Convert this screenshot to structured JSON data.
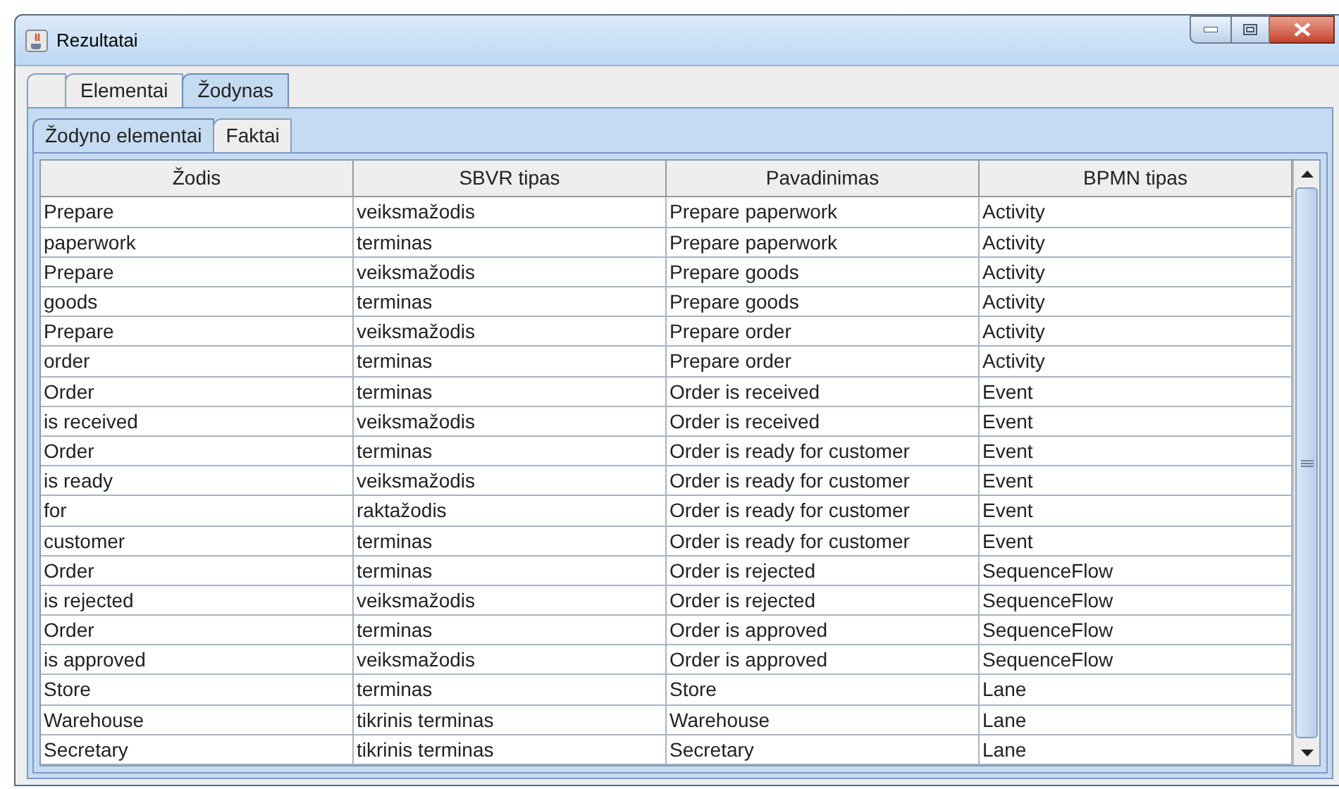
{
  "window": {
    "title": "Rezultatai"
  },
  "tabs": [
    {
      "selected": false
    },
    {
      "label": "Elementai",
      "selected": false
    },
    {
      "label": "Žodynas",
      "selected": true
    }
  ],
  "subtabs": [
    {
      "label": "Žodyno elementai",
      "selected": true
    },
    {
      "label": "Faktai",
      "selected": false
    }
  ],
  "table": {
    "columns": [
      "Žodis",
      "SBVR tipas",
      "Pavadinimas",
      "BPMN tipas"
    ],
    "rows": [
      [
        "Prepare",
        "veiksmažodis",
        "Prepare paperwork",
        "Activity"
      ],
      [
        "paperwork",
        "terminas",
        "Prepare paperwork",
        "Activity"
      ],
      [
        "Prepare",
        "veiksmažodis",
        "Prepare goods",
        "Activity"
      ],
      [
        "goods",
        "terminas",
        "Prepare goods",
        "Activity"
      ],
      [
        "Prepare",
        "veiksmažodis",
        "Prepare order",
        "Activity"
      ],
      [
        "order",
        "terminas",
        "Prepare order",
        "Activity"
      ],
      [
        "Order",
        "terminas",
        "Order is received",
        "Event"
      ],
      [
        "is received",
        "veiksmažodis",
        "Order is received",
        "Event"
      ],
      [
        "Order",
        "terminas",
        "Order is ready for customer",
        "Event"
      ],
      [
        "is ready",
        "veiksmažodis",
        "Order is ready for customer",
        "Event"
      ],
      [
        "for",
        "raktažodis",
        "Order is ready for customer",
        "Event"
      ],
      [
        "customer",
        "terminas",
        "Order is ready for customer",
        "Event"
      ],
      [
        "Order",
        "terminas",
        "Order is rejected",
        "SequenceFlow"
      ],
      [
        "is rejected",
        "veiksmažodis",
        "Order is rejected",
        "SequenceFlow"
      ],
      [
        "Order",
        "terminas",
        "Order is approved",
        "SequenceFlow"
      ],
      [
        "is approved",
        "veiksmažodis",
        "Order is approved",
        "SequenceFlow"
      ],
      [
        "Store",
        "terminas",
        "Store",
        "Lane"
      ],
      [
        "Warehouse",
        "tikrinis terminas",
        "Warehouse",
        "Lane"
      ],
      [
        "Secretary",
        "tikrinis terminas",
        "Secretary",
        "Lane"
      ]
    ]
  }
}
